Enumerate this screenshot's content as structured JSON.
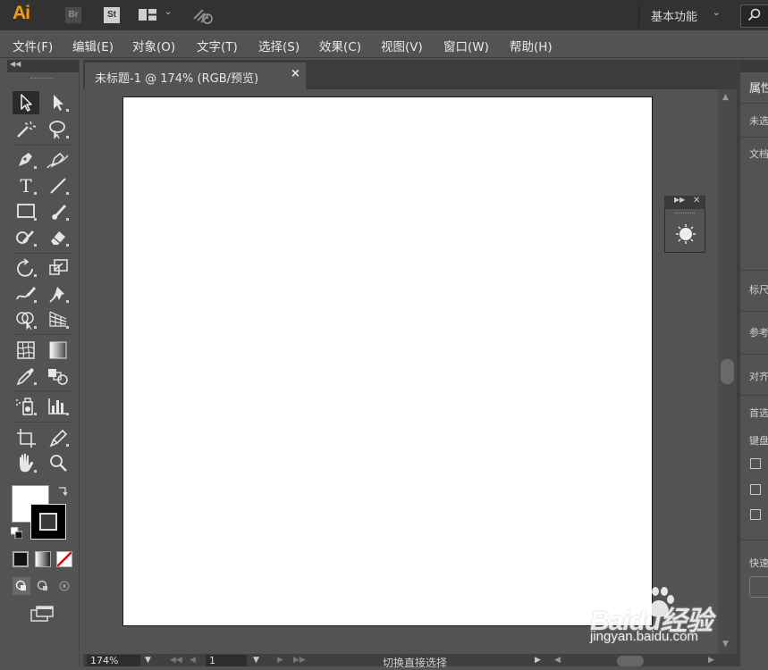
{
  "titlebar": {
    "app_logo": "Ai",
    "bridge_label": "Br",
    "stock_label": "St",
    "workspace": "基本功能"
  },
  "menu": [
    "文件(F)",
    "编辑(E)",
    "对象(O)",
    "文字(T)",
    "选择(S)",
    "效果(C)",
    "视图(V)",
    "窗口(W)",
    "帮助(H)"
  ],
  "document_tab": {
    "title": "未标题-1 @ 174% (RGB/预览)",
    "close_glyph": "×"
  },
  "tools": [
    "selection-tool",
    "direct-selection-tool",
    "magic-wand-tool",
    "lasso-tool",
    "pen-tool",
    "curvature-tool",
    "type-tool",
    "line-segment-tool",
    "rectangle-tool",
    "paintbrush-tool",
    "shaper-tool",
    "eraser-tool",
    "rotate-tool",
    "scale-tool",
    "warp-tool",
    "puppet-warp-tool",
    "shape-builder-tool",
    "perspective-grid-tool",
    "mesh-tool",
    "gradient-tool",
    "eyedropper-tool",
    "blend-tool",
    "symbol-sprayer-tool",
    "column-graph-tool",
    "artboard-tool",
    "slice-tool",
    "hand-tool",
    "zoom-tool"
  ],
  "colors": {
    "fill": "#ffffff",
    "stroke": "#000000",
    "accent_logo": "#ff9a00"
  },
  "right_panel": {
    "title": "属性",
    "labels": [
      "未选",
      "文档",
      "标尺",
      "参考",
      "对齐",
      "首选",
      "键盘",
      "快速"
    ]
  },
  "statusbar": {
    "zoom": "174%",
    "page": "1",
    "status_text": "切换直接选择"
  },
  "watermark": {
    "brand": "Baidu经验",
    "url": "jingyan.baidu.com"
  }
}
